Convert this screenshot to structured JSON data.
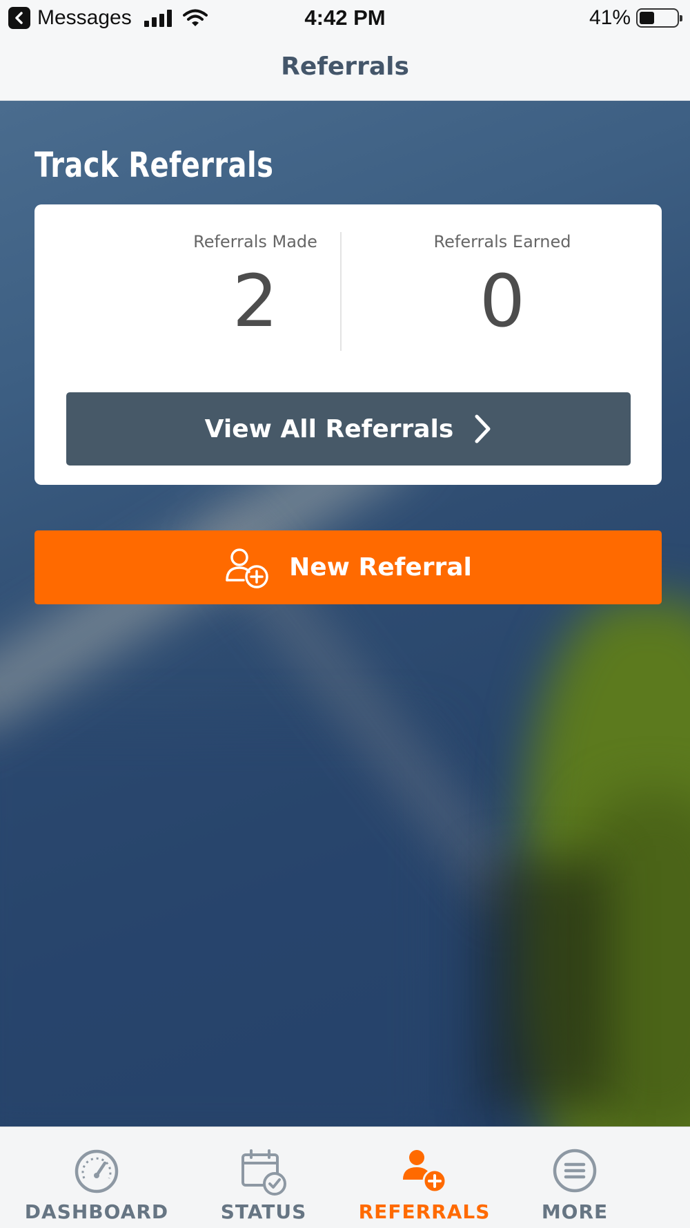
{
  "status_bar": {
    "back_app": "Messages",
    "time": "4:42 PM",
    "battery_percent": "41%",
    "battery_level": 0.41
  },
  "header": {
    "title": "Referrals"
  },
  "section": {
    "title": "Track Referrals"
  },
  "stats": {
    "made_label": "Referrals Made",
    "made_value": "2",
    "earned_label": "Referrals Earned",
    "earned_value": "0"
  },
  "buttons": {
    "view_all": "View All Referrals",
    "new_referral": "New Referral"
  },
  "colors": {
    "accent": "#ff6a00",
    "button_dark": "#475968",
    "tab_inactive": "#667583",
    "header_text": "#44566a"
  },
  "tabs": [
    {
      "label": "DASHBOARD",
      "icon": "speedometer-icon",
      "active": false
    },
    {
      "label": "STATUS",
      "icon": "calendar-check-icon",
      "active": false
    },
    {
      "label": "REFERRALS",
      "icon": "user-add-icon",
      "active": true
    },
    {
      "label": "MORE",
      "icon": "menu-circle-icon",
      "active": false
    }
  ]
}
